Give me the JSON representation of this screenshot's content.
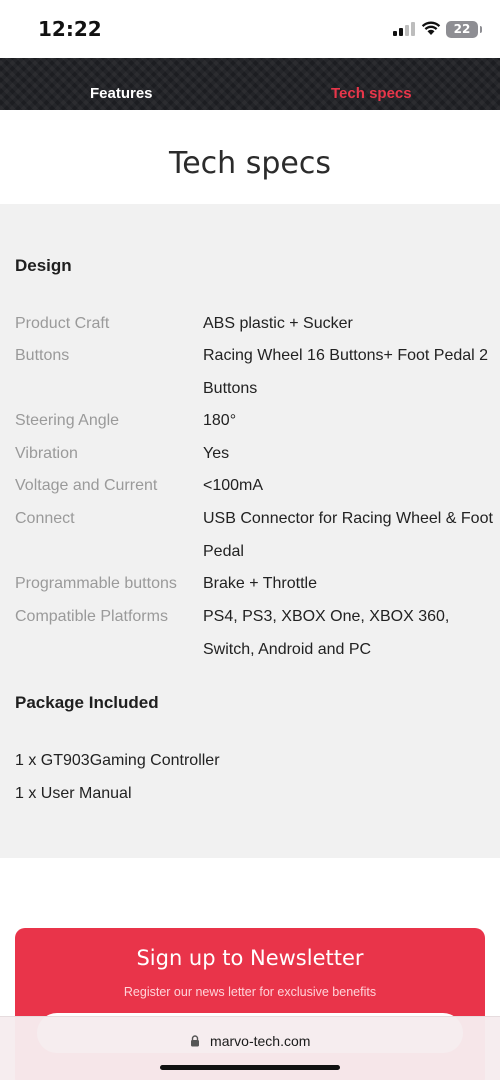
{
  "status_bar": {
    "time": "12:22",
    "battery": "22"
  },
  "nav": {
    "tabs": [
      {
        "label": "Features",
        "active": false
      },
      {
        "label": "Tech specs",
        "active": true
      }
    ],
    "active_color": "#e8364a"
  },
  "page_title": "Tech specs",
  "design": {
    "heading": "Design",
    "specs": [
      {
        "label": "Product Craft",
        "value": "ABS plastic + Sucker"
      },
      {
        "label": "Buttons",
        "value": "Racing Wheel 16 Buttons+ Foot Pedal 2 Buttons"
      },
      {
        "label": "Steering Angle",
        "value": "180°"
      },
      {
        "label": "Vibration",
        "value": "Yes"
      },
      {
        "label": "Voltage and Current",
        "value": "<100mA"
      },
      {
        "label": "Connect",
        "value": "USB Connector for Racing Wheel & Foot Pedal"
      },
      {
        "label": "Programmable buttons",
        "value": "Brake + Throttle"
      },
      {
        "label": "Compatible Platforms",
        "value": "PS4, PS3, XBOX One, XBOX 360, Switch, Android and PC"
      }
    ]
  },
  "package": {
    "heading": "Package Included",
    "items": [
      "1 x GT903Gaming Controller",
      "1 x User Manual"
    ]
  },
  "newsletter": {
    "title": "Sign up to Newsletter",
    "subtitle": "Register our news letter for exclusive benefits",
    "color": "#e9344a"
  },
  "browser": {
    "url": "marvo-tech.com"
  }
}
